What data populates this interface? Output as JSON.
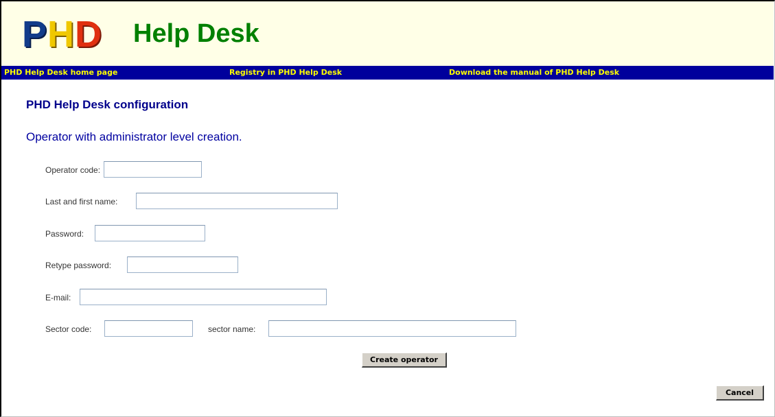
{
  "header": {
    "logo": {
      "p": "P",
      "h": "H",
      "d": "D"
    },
    "title": "Help Desk"
  },
  "nav": {
    "home": "PHD Help Desk home page",
    "registry": "Registry in PHD Help Desk",
    "manual": "Download the manual of PHD Help Desk"
  },
  "page": {
    "config_title": "PHD Help Desk configuration",
    "subtitle": "Operator with administrator level creation."
  },
  "form": {
    "operator_code": {
      "label": "Operator code:",
      "value": ""
    },
    "name": {
      "label": "Last and first name:",
      "value": ""
    },
    "password": {
      "label": "Password:",
      "value": ""
    },
    "retype_password": {
      "label": "Retype password:",
      "value": ""
    },
    "email": {
      "label": "E-mail:",
      "value": ""
    },
    "sector_code": {
      "label": "Sector code:",
      "value": ""
    },
    "sector_name": {
      "label": "sector name:",
      "value": ""
    },
    "create_button": "Create operator",
    "cancel_button": "Cancel"
  },
  "colors": {
    "header_bg": "#ffffe7",
    "title_green": "#008000",
    "nav_bg": "#00009c",
    "nav_text": "#ffff00",
    "heading_blue": "#00008b"
  }
}
